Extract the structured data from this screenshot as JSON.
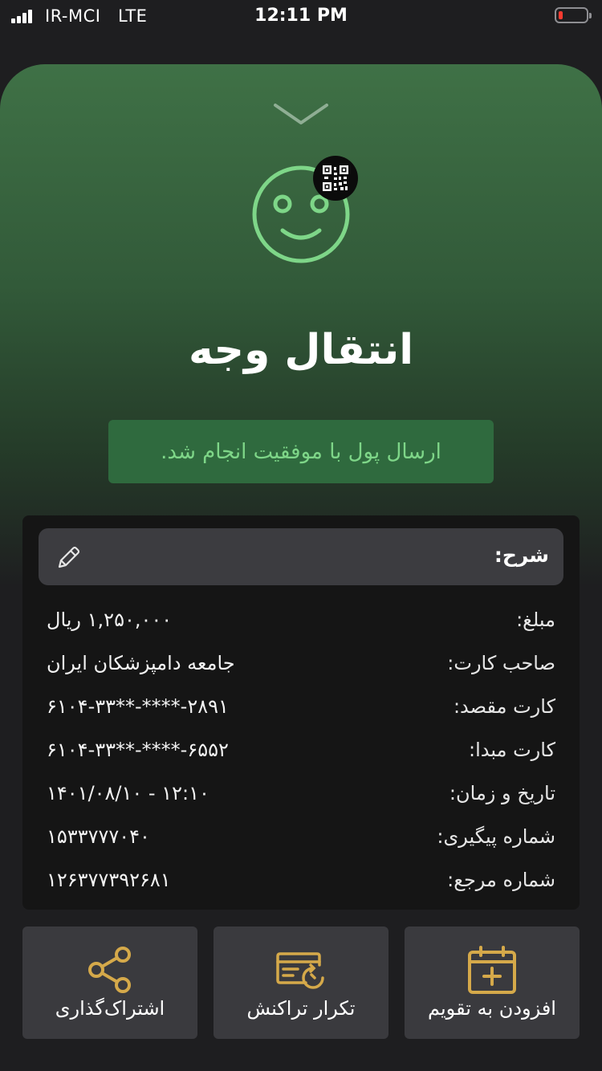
{
  "status_bar": {
    "carrier": "IR-MCI   LTE",
    "time": "12:11 PM"
  },
  "header": {
    "title": "انتقال وجه",
    "success_message": "ارسال پول با موفقیت انجام شد."
  },
  "details": {
    "description_label": "شرح:",
    "rows": [
      {
        "label": "مبلغ:",
        "value": "۱,۲۵۰,۰۰۰ ریال"
      },
      {
        "label": "صاحب کارت:",
        "value": "جامعه دامپزشکان ایران"
      },
      {
        "label": "کارت مقصد:",
        "value": "۶۱۰۴-۳۳**-****-۲۸۹۱"
      },
      {
        "label": "کارت مبدا:",
        "value": "۶۱۰۴-۳۳**-****-۶۵۵۲"
      },
      {
        "label": "تاریخ و زمان:",
        "value": "۱۴۰۱/۰۸/۱۰ - ۱۲:۱۰"
      },
      {
        "label": "شماره پیگیری:",
        "value": "۱۵۳۳۷۷۷۰۴۰"
      },
      {
        "label": "شماره مرجع:",
        "value": "۱۲۶۳۷۷۳۹۲۶۸۱"
      }
    ]
  },
  "actions": {
    "add_to_calendar": "افزودن به تقویم",
    "repeat_transaction": "تکرار تراکنش",
    "share": "اشتراک‌گذاری"
  },
  "icons": {
    "chevron": "chevron-down-icon",
    "smiley": "smiley-icon",
    "qr": "qr-code-icon",
    "pencil": "pencil-icon",
    "calendar": "calendar-add-icon",
    "repeat": "card-repeat-icon",
    "share": "share-icon"
  },
  "colors": {
    "accent_green": "#7ed688",
    "success_bg": "#2f6a3e",
    "gold": "#d5a94a",
    "panel": "#151515",
    "button_bg": "#3a3a3e"
  }
}
